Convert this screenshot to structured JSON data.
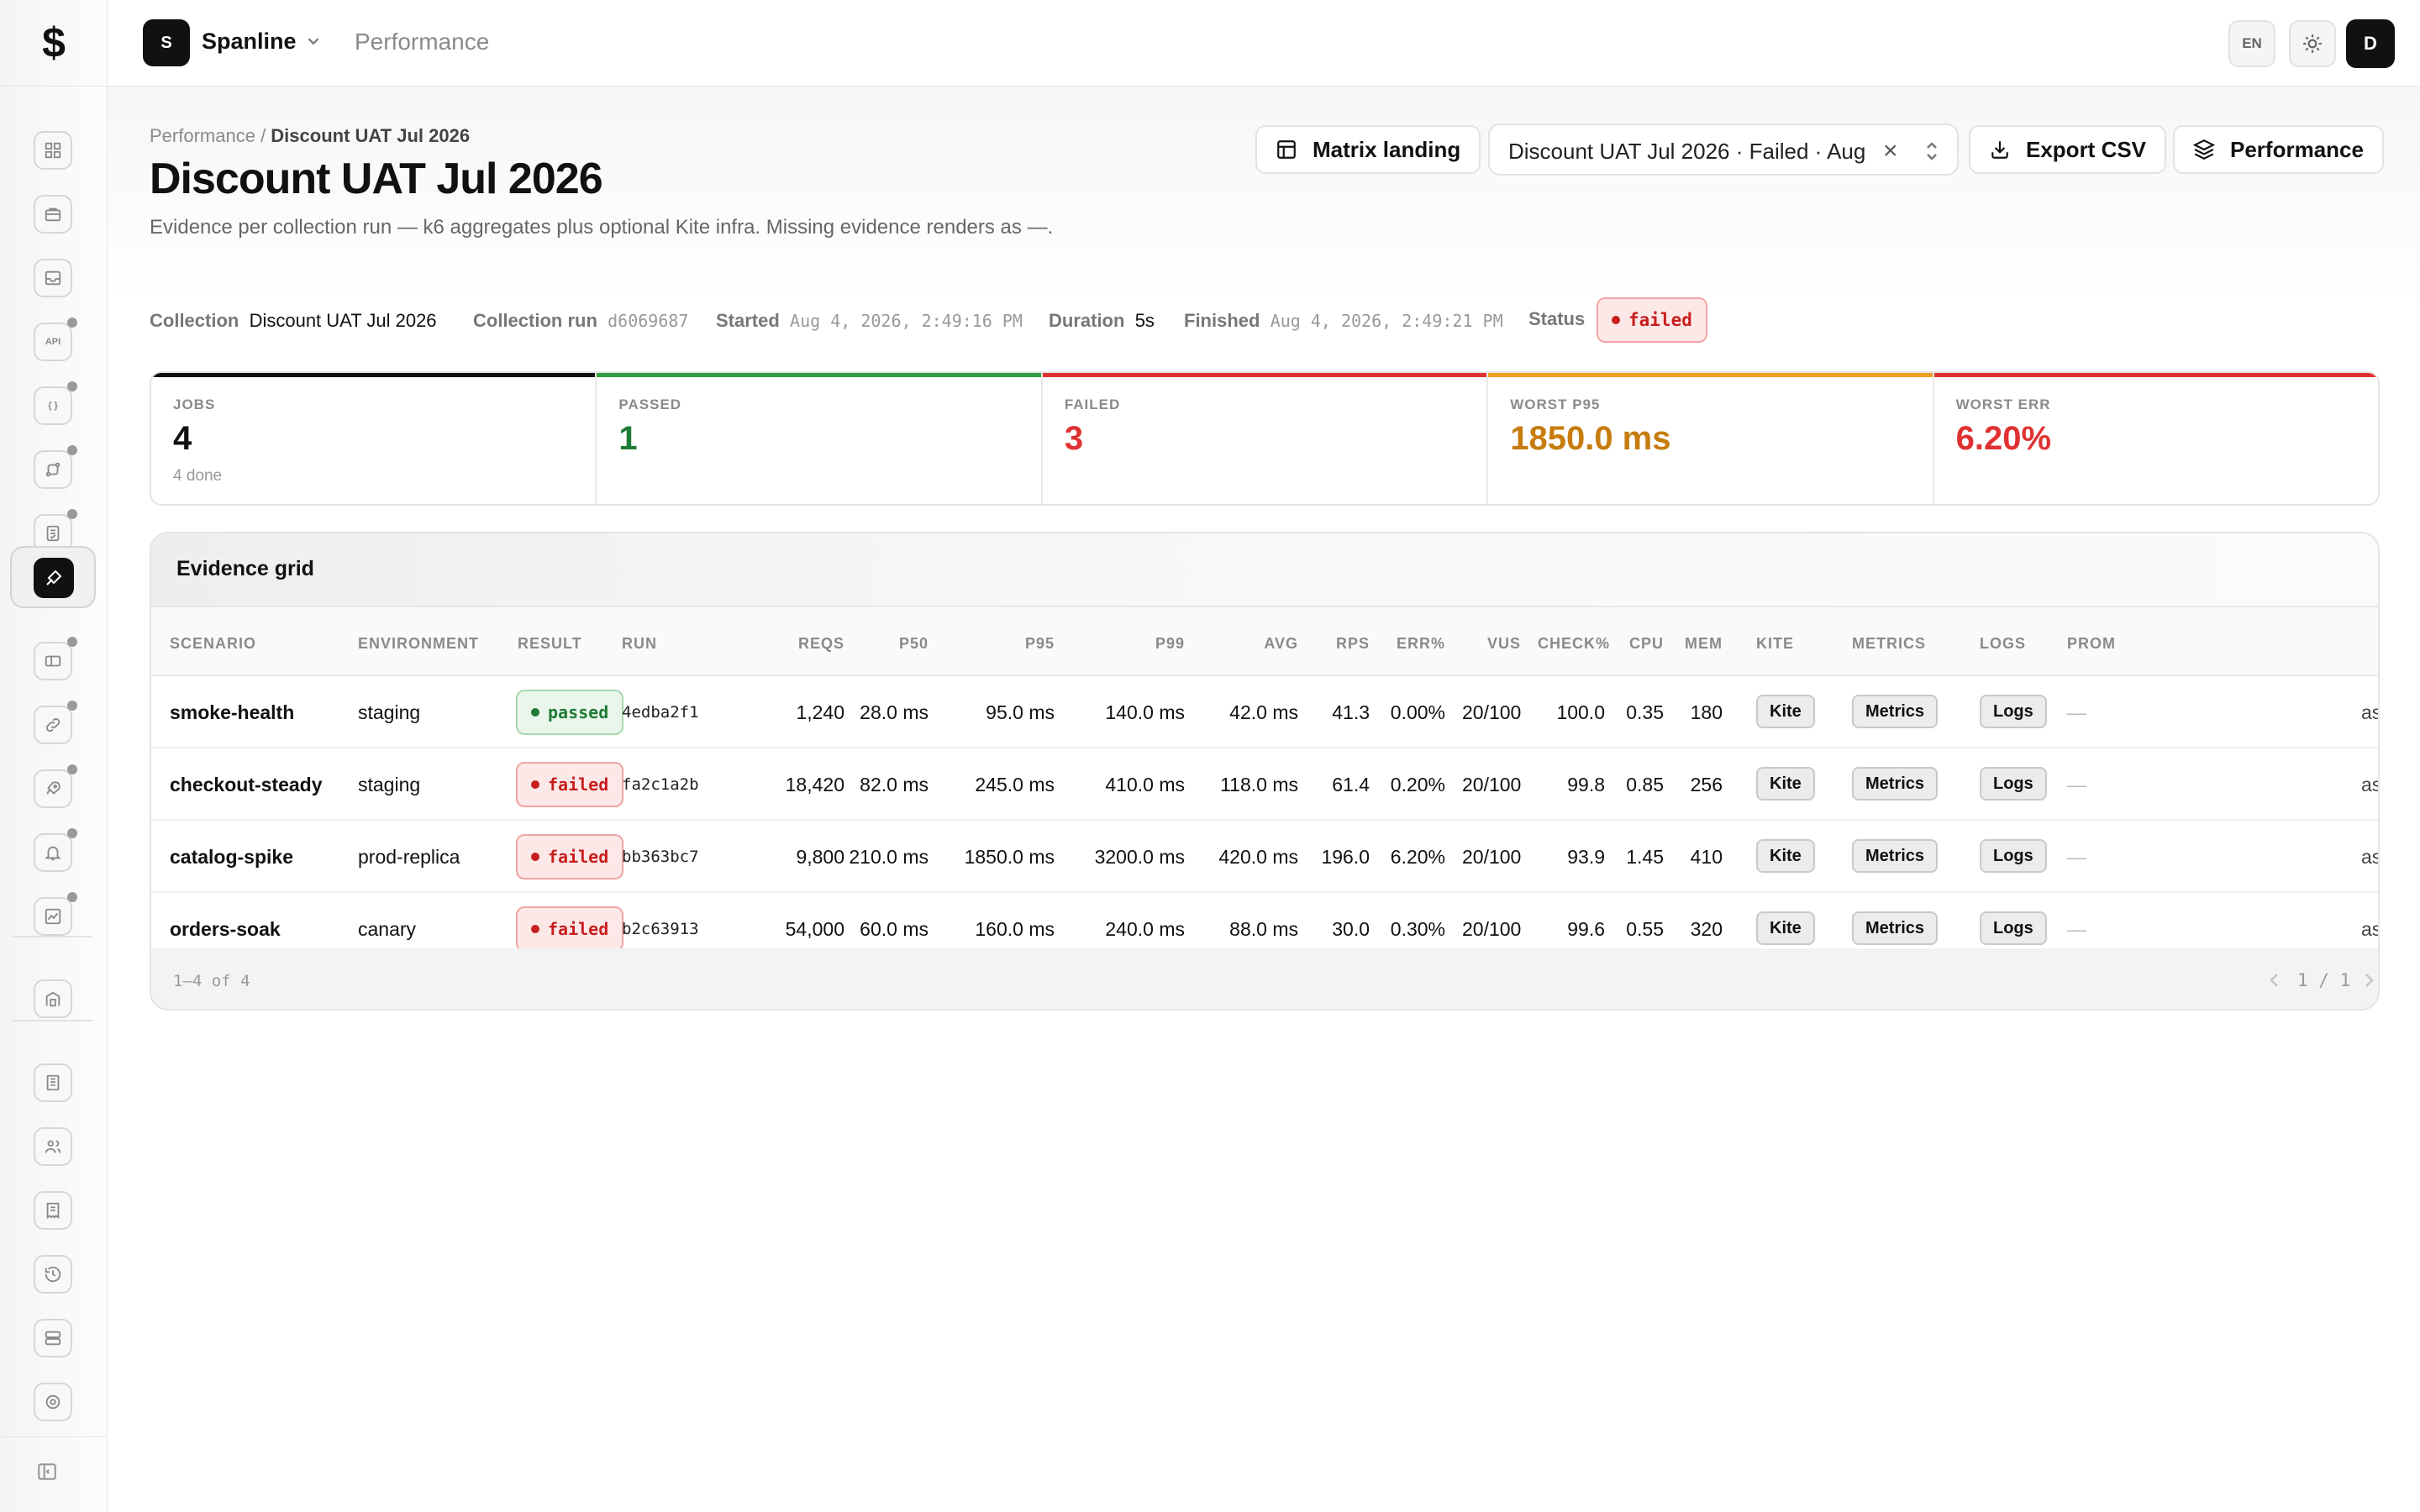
{
  "app": {
    "logo_glyph": "$",
    "workspace_initial": "S",
    "workspace_name": "Spanline",
    "section": "Performance",
    "lang": "EN",
    "user_initial": "D"
  },
  "sidebar": {
    "items": [
      {
        "name": "dashboard-icon"
      },
      {
        "name": "briefcase-icon"
      },
      {
        "name": "inbox-icon"
      },
      {
        "name": "api-icon",
        "text": "API"
      },
      {
        "name": "braces-icon",
        "text": "{ }"
      },
      {
        "name": "route-icon"
      },
      {
        "name": "checklist-icon"
      },
      {
        "name": "performance-icon",
        "active": true
      },
      {
        "name": "ticket-icon"
      },
      {
        "name": "link-icon"
      },
      {
        "name": "rocket-icon"
      },
      {
        "name": "bell-icon"
      },
      {
        "name": "chart-icon"
      },
      {
        "name": "building-icon"
      },
      {
        "name": "ledger-icon"
      },
      {
        "name": "users-icon"
      },
      {
        "name": "receipt-icon"
      },
      {
        "name": "history-icon"
      },
      {
        "name": "server-icon"
      },
      {
        "name": "settings-icon"
      }
    ]
  },
  "page": {
    "breadcrumb_parent": "Performance",
    "breadcrumb_sep": " / ",
    "breadcrumb_current": "Discount UAT Jul 2026",
    "title": "Discount UAT Jul 2026",
    "description": "Evidence per collection run — k6 aggregates plus optional Kite infra. Missing evidence renders as —."
  },
  "actions": {
    "matrix_label": "Matrix landing",
    "run_select_value": "Discount UAT Jul 2026 · Failed · Aug",
    "export_label": "Export CSV",
    "performance_label": "Performance"
  },
  "meta": {
    "collection_label": "Collection",
    "collection_value": "Discount UAT Jul 2026",
    "run_label": "Collection run",
    "run_value": "d6069687",
    "started_label": "Started",
    "started_value": "Aug 4, 2026, 2:49:16 PM",
    "duration_label": "Duration",
    "duration_value": "5s",
    "finished_label": "Finished",
    "finished_value": "Aug 4, 2026, 2:49:21 PM",
    "status_label": "Status",
    "status_value": "failed"
  },
  "stats": [
    {
      "label": "JOBS",
      "value": "4",
      "sub": "4 done",
      "color": "#111111",
      "bar": "#111111"
    },
    {
      "label": "PASSED",
      "value": "1",
      "sub": "",
      "color": "#1e7b34",
      "bar": "#2f9e44"
    },
    {
      "label": "FAILED",
      "value": "3",
      "sub": "",
      "color": "#e03131",
      "bar": "#e03131"
    },
    {
      "label": "WORST P95",
      "value": "1850.0 ms",
      "sub": "",
      "color": "#c77c0e",
      "bar": "#f0a020"
    },
    {
      "label": "WORST ERR",
      "value": "6.20%",
      "sub": "",
      "color": "#e03131",
      "bar": "#e03131"
    }
  ],
  "grid": {
    "title": "Evidence grid",
    "columns": [
      "SCENARIO",
      "ENVIRONMENT",
      "RESULT",
      "RUN",
      "REQS",
      "P50",
      "P95",
      "P99",
      "AVG",
      "RPS",
      "ERR%",
      "VUS",
      "CHECK%",
      "CPU",
      "MEM",
      "KITE",
      "METRICS",
      "LOGS",
      "PROM"
    ],
    "rows": [
      {
        "scenario": "smoke-health",
        "environment": "staging",
        "result": "passed",
        "run": "4edba2f1",
        "reqs": "1,240",
        "p50": "28.0 ms",
        "p95": "95.0 ms",
        "p99": "140.0 ms",
        "avg": "42.0 ms",
        "rps": "41.3",
        "err": "0.00%",
        "vus": "20/100",
        "check": "100.0",
        "cpu": "0.35",
        "mem": "180",
        "kite": "Kite",
        "metrics": "Metrics",
        "logs": "Logs",
        "prom": "—",
        "extra": "as"
      },
      {
        "scenario": "checkout-steady",
        "environment": "staging",
        "result": "failed",
        "run": "fa2c1a2b",
        "reqs": "18,420",
        "p50": "82.0 ms",
        "p95": "245.0 ms",
        "p99": "410.0 ms",
        "avg": "118.0 ms",
        "rps": "61.4",
        "err": "0.20%",
        "vus": "20/100",
        "check": "99.8",
        "cpu": "0.85",
        "mem": "256",
        "kite": "Kite",
        "metrics": "Metrics",
        "logs": "Logs",
        "prom": "—",
        "extra": "as"
      },
      {
        "scenario": "catalog-spike",
        "environment": "prod-replica",
        "result": "failed",
        "run": "bb363bc7",
        "reqs": "9,800",
        "p50": "210.0 ms",
        "p95": "1850.0 ms",
        "p99": "3200.0 ms",
        "avg": "420.0 ms",
        "rps": "196.0",
        "err": "6.20%",
        "vus": "20/100",
        "check": "93.9",
        "cpu": "1.45",
        "mem": "410",
        "kite": "Kite",
        "metrics": "Metrics",
        "logs": "Logs",
        "prom": "—",
        "extra": "as"
      },
      {
        "scenario": "orders-soak",
        "environment": "canary",
        "result": "failed",
        "run": "b2c63913",
        "reqs": "54,000",
        "p50": "60.0 ms",
        "p95": "160.0 ms",
        "p99": "240.0 ms",
        "avg": "88.0 ms",
        "rps": "30.0",
        "err": "0.30%",
        "vus": "20/100",
        "check": "99.6",
        "cpu": "0.55",
        "mem": "320",
        "kite": "Kite",
        "metrics": "Metrics",
        "logs": "Logs",
        "prom": "—",
        "extra": "as"
      }
    ],
    "footer_count": "1–4 of 4",
    "page_indicator": "1 / 1"
  }
}
